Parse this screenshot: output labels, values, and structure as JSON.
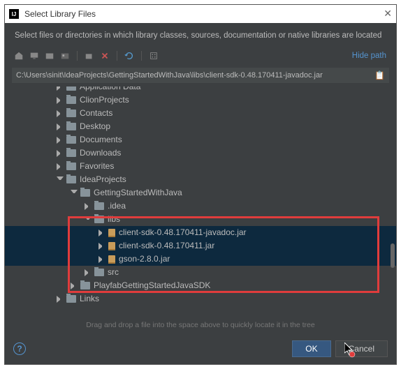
{
  "titlebar": {
    "title": "Select Library Files"
  },
  "subtitle": "Select files or directories in which library classes, sources, documentation or native libraries are located",
  "toolbar": {
    "hide_path": "Hide path"
  },
  "path": "C:\\Users\\sinit\\IdeaProjects\\GettingStartedWithJava\\libs\\client-sdk-0.48.170411-javadoc.jar",
  "tree": {
    "items": [
      {
        "indent": 72,
        "arrow": "right",
        "icon": "folder",
        "label": "Application Data",
        "sel": false
      },
      {
        "indent": 72,
        "arrow": "right",
        "icon": "folder",
        "label": "ClionProjects",
        "sel": false
      },
      {
        "indent": 72,
        "arrow": "right",
        "icon": "folder",
        "label": "Contacts",
        "sel": false
      },
      {
        "indent": 72,
        "arrow": "right",
        "icon": "folder",
        "label": "Desktop",
        "sel": false
      },
      {
        "indent": 72,
        "arrow": "right",
        "icon": "folder",
        "label": "Documents",
        "sel": false
      },
      {
        "indent": 72,
        "arrow": "right",
        "icon": "folder",
        "label": "Downloads",
        "sel": false
      },
      {
        "indent": 72,
        "arrow": "right",
        "icon": "folder",
        "label": "Favorites",
        "sel": false
      },
      {
        "indent": 72,
        "arrow": "down",
        "icon": "folder",
        "label": "IdeaProjects",
        "sel": false
      },
      {
        "indent": 92,
        "arrow": "down",
        "icon": "folder",
        "label": "GettingStartedWithJava",
        "sel": false
      },
      {
        "indent": 112,
        "arrow": "right",
        "icon": "folder",
        "label": ".idea",
        "sel": false
      },
      {
        "indent": 112,
        "arrow": "down",
        "icon": "folder",
        "label": "libs",
        "sel": false
      },
      {
        "indent": 132,
        "arrow": "right",
        "icon": "jar",
        "label": "client-sdk-0.48.170411-javadoc.jar",
        "sel": true
      },
      {
        "indent": 132,
        "arrow": "right",
        "icon": "jar",
        "label": "client-sdk-0.48.170411.jar",
        "sel": true
      },
      {
        "indent": 132,
        "arrow": "right",
        "icon": "jar",
        "label": "gson-2.8.0.jar",
        "sel": true
      },
      {
        "indent": 112,
        "arrow": "right",
        "icon": "folder",
        "label": "src",
        "sel": false
      },
      {
        "indent": 92,
        "arrow": "right",
        "icon": "folder",
        "label": "PlayfabGettingStartedJavaSDK",
        "sel": false
      },
      {
        "indent": 72,
        "arrow": "right",
        "icon": "folder",
        "label": "Links",
        "sel": false
      }
    ]
  },
  "hint": "Drag and drop a file into the space above to quickly locate it in the tree",
  "footer": {
    "ok": "OK",
    "cancel": "Cancel"
  }
}
